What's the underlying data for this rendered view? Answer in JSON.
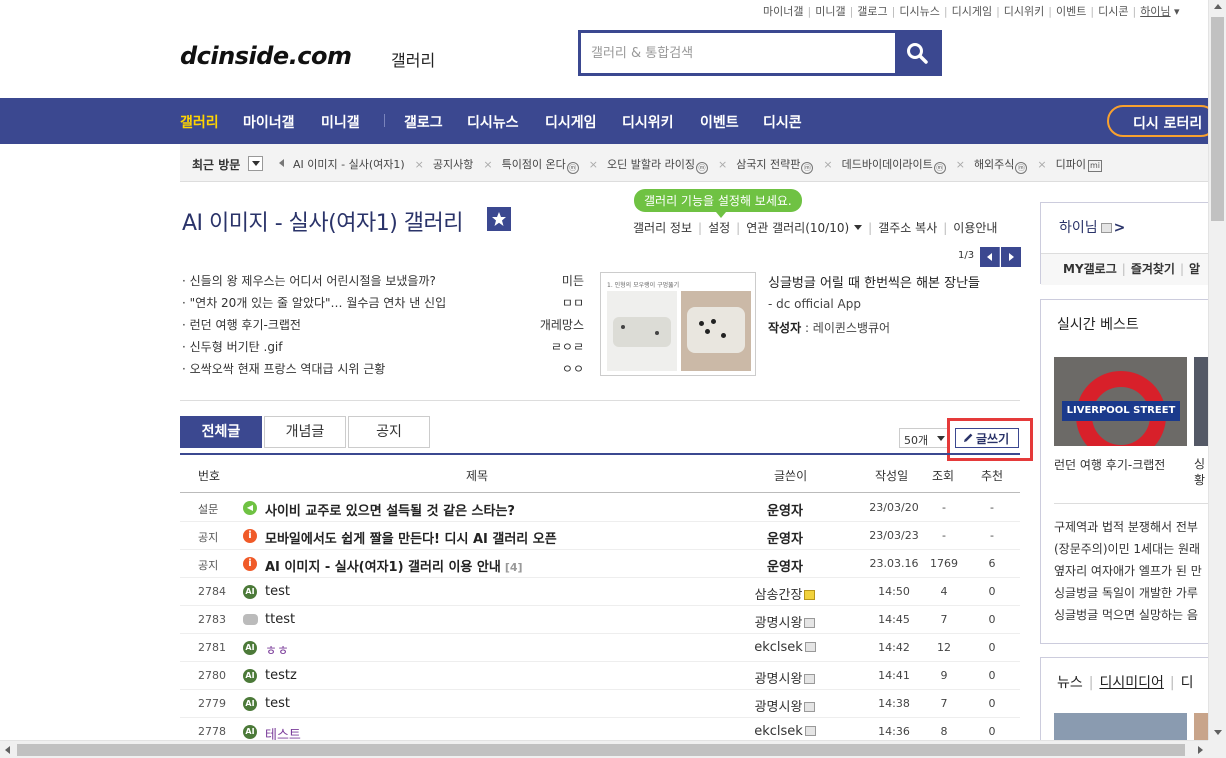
{
  "top_links": [
    "마이너갤",
    "미니갤",
    "갤로그",
    "디시뉴스",
    "디시게임",
    "디시위키",
    "이벤트",
    "디시콘"
  ],
  "top_user": "하이님",
  "logo": "dcinside.com",
  "logo_sub": "갤러리",
  "search": {
    "placeholder": "갤러리 & 통합검색"
  },
  "nav": {
    "items": [
      "갤러리",
      "마이너갤",
      "미니갤",
      "갤로그",
      "디시뉴스",
      "디시게임",
      "디시위키",
      "이벤트",
      "디시콘"
    ],
    "lottery": "디시 로터리"
  },
  "recent": {
    "label": "최근 방문",
    "items": [
      {
        "name": "AI 이미지 - 실사(여자1)",
        "badge": ""
      },
      {
        "name": "공지사항",
        "badge": ""
      },
      {
        "name": "특이점이 온다",
        "badge": "ⓜ"
      },
      {
        "name": "오딘 발할라 라이징",
        "badge": "ⓜ"
      },
      {
        "name": "삼국지 전략판",
        "badge": "ⓜ"
      },
      {
        "name": "데드바이데이라이트",
        "badge": "ⓜ"
      },
      {
        "name": "해외주식",
        "badge": "ⓜ"
      },
      {
        "name": "디파이",
        "badge": "mi"
      }
    ]
  },
  "gallery": {
    "title": "AI 이미지 - 실사(여자1) 갤러리",
    "tooltip": "갤러리 기능을 설정해 보세요.",
    "info": {
      "info": "갤러리 정보",
      "settings": "설정",
      "related": "연관 갤러리(10/10)",
      "copy": "갤주소 복사",
      "guide": "이용안내"
    },
    "pager": "1/3"
  },
  "concepts": [
    {
      "title": "· 신들의 왕 제우스는 어디서 어린시절을 보냈을까?",
      "author": "미든"
    },
    {
      "title": "· \"연차 20개 있는 줄 알았다\"… 월수금 연차 낸 신입",
      "author": "ㅁㅁ"
    },
    {
      "title": "· 런던 여행 후기-크랩전",
      "author": "개레망스"
    },
    {
      "title": "· 신두형 버기탄 .gif",
      "author": "ㄹㅇㄹ"
    },
    {
      "title": "· 오싹오싹 현재 프랑스 역대급 시위 근황",
      "author": "ㅇㅇ"
    }
  ],
  "featured": {
    "title": "싱글벙글 어릴 때 한번씩은 해본 장난들",
    "source": "- dc official App",
    "author_label": "작성자",
    "author": "레이퀸스뱅큐어",
    "thumb_caption": "1. 인형의 모우랭이 구멍뚫기"
  },
  "tabs": [
    "전체글",
    "개념글",
    "공지"
  ],
  "per_page": "50개",
  "write_button": "글쓰기",
  "table": {
    "headers": [
      "번호",
      "제목",
      "글쓴이",
      "작성일",
      "조회",
      "추천"
    ],
    "rows": [
      {
        "no": "설문",
        "icon": "spk",
        "title": "사이비 교주로 있으면 설득될 것 같은 스타는?",
        "comments": "",
        "writer": "운영자",
        "date": "23/03/20",
        "views": "-",
        "rec": "-",
        "bold": true,
        "color": "",
        "uicon": ""
      },
      {
        "no": "공지",
        "icon": "notice",
        "title": "모바일에서도 쉽게 짤을 만든다! 디시 AI 갤러리 오픈",
        "comments": "",
        "writer": "운영자",
        "date": "23/03/23",
        "views": "-",
        "rec": "-",
        "bold": true,
        "color": "",
        "uicon": ""
      },
      {
        "no": "공지",
        "icon": "notice",
        "title": "AI 이미지 - 실사(여자1) 갤러리 이용 안내",
        "comments": "[4]",
        "writer": "운영자",
        "date": "23.03.16",
        "views": "1769",
        "rec": "6",
        "bold": true,
        "color": "",
        "uicon": ""
      },
      {
        "no": "2784",
        "icon": "ai",
        "title": "test",
        "comments": "",
        "writer": "삼송간장",
        "date": "14:50",
        "views": "4",
        "rec": "0",
        "bold": false,
        "color": "",
        "uicon": "gold"
      },
      {
        "no": "2783",
        "icon": "cmt",
        "title": "ttest",
        "comments": "",
        "writer": "광명시왕",
        "date": "14:45",
        "views": "7",
        "rec": "0",
        "bold": false,
        "color": "",
        "uicon": "gray"
      },
      {
        "no": "2781",
        "icon": "ai",
        "title": "ㅎㅎ",
        "comments": "",
        "writer": "ekclsek",
        "date": "14:42",
        "views": "12",
        "rec": "0",
        "bold": false,
        "color": "purple",
        "uicon": "gray"
      },
      {
        "no": "2780",
        "icon": "ai",
        "title": "testz",
        "comments": "",
        "writer": "광명시왕",
        "date": "14:41",
        "views": "9",
        "rec": "0",
        "bold": false,
        "color": "",
        "uicon": "gray"
      },
      {
        "no": "2779",
        "icon": "ai",
        "title": "test",
        "comments": "",
        "writer": "광명시왕",
        "date": "14:38",
        "views": "7",
        "rec": "0",
        "bold": false,
        "color": "",
        "uicon": "gray"
      },
      {
        "no": "2778",
        "icon": "ai",
        "title": "테스트",
        "comments": "",
        "writer": "ekclsek",
        "date": "14:36",
        "views": "8",
        "rec": "0",
        "bold": false,
        "color": "purple",
        "uicon": "gray"
      }
    ]
  },
  "right": {
    "greeting": "하이님",
    "my_links": [
      "MY갤로그",
      "즐겨찾기",
      "알"
    ],
    "best_title": "실시간 베스트",
    "best_img_sign": "LIVERPOOL STREET",
    "best_cap1": "런던 여행 후기-크랩전",
    "best_cap2": "싱황",
    "best_texts": [
      "구제역과 법적 분쟁해서 전부",
      "(장문주의)이민 1세대는 원래",
      "옆자리 여자애가 엘프가 된 만",
      "싱글벙글 독일이 개발한 가루",
      "싱글벙글 먹으면 실망하는 음"
    ],
    "news_tabs": [
      "뉴스",
      "디시미디어",
      "디"
    ]
  },
  "colors": {
    "brand": "#3b4890",
    "active_nav": "#ffd400",
    "highlight": "#e53a3a",
    "tooltip": "#6fc243"
  }
}
